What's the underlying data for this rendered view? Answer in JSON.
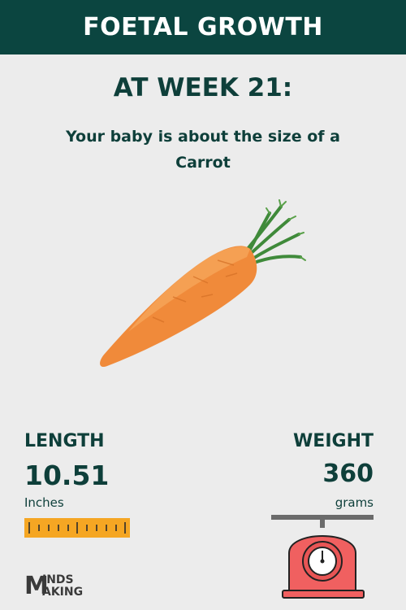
{
  "header": {
    "title": "FOETAL GROWTH"
  },
  "week": {
    "heading": "AT WEEK 21:"
  },
  "size": {
    "line1": "Your baby is about the size of a",
    "fruit": "Carrot"
  },
  "length": {
    "label": "LENGTH",
    "value": "10.51",
    "unit": "Inches"
  },
  "weight": {
    "label": "WEIGHT",
    "value": "360",
    "unit": "grams"
  },
  "logo": {
    "letter": "M",
    "top": "INDS",
    "bottom": "AKING"
  },
  "colors": {
    "header_bg": "#0b4540",
    "text": "#0e3f3a",
    "ruler": "#f5a623",
    "scale": "#f06060",
    "carrot": "#f08a3a",
    "leaves": "#3f8a3a"
  },
  "icons": [
    "carrot-image",
    "ruler-icon",
    "kitchen-scale-icon",
    "minds-making-logo"
  ]
}
